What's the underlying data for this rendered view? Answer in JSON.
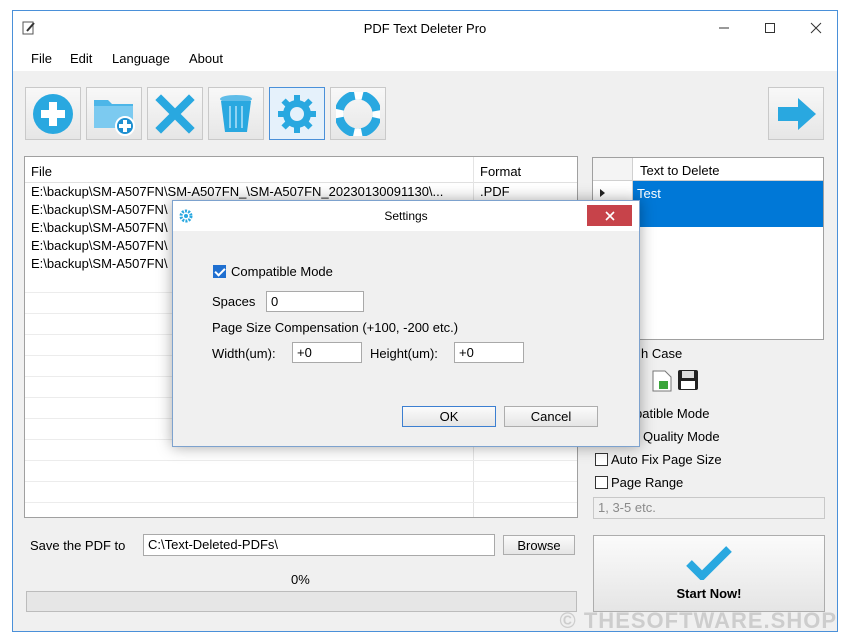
{
  "window": {
    "title": "PDF Text Deleter Pro"
  },
  "menu": [
    "File",
    "Edit",
    "Language",
    "About"
  ],
  "toolbar": {
    "buttons": [
      {
        "icon": "add-icon"
      },
      {
        "icon": "add-folder-icon"
      },
      {
        "icon": "remove-icon"
      },
      {
        "icon": "trash-icon"
      },
      {
        "icon": "gear-icon"
      },
      {
        "icon": "help-lifebuoy-icon"
      }
    ],
    "next_icon": "arrow-right-icon"
  },
  "file_table": {
    "headers": {
      "file": "File",
      "format": "Format"
    },
    "rows": [
      {
        "file": "E:\\backup\\SM-A507FN\\SM-A507FN_\\SM-A507FN_20230130091130\\...",
        "format": ".PDF"
      },
      {
        "file": "E:\\backup\\SM-A507FN\\",
        "format": ""
      },
      {
        "file": "E:\\backup\\SM-A507FN\\",
        "format": ""
      },
      {
        "file": "E:\\backup\\SM-A507FN\\",
        "format": ""
      },
      {
        "file": "E:\\backup\\SM-A507FN\\",
        "format": ""
      }
    ]
  },
  "delete_table": {
    "header": "Text to Delete",
    "rows": [
      "Test",
      ""
    ]
  },
  "options": {
    "match_case": "h Case",
    "compatible_mode": "patible Mode",
    "quality_mode": "Quality Mode",
    "auto_fix": "Auto Fix Page Size",
    "page_range": "Page Range",
    "page_range_placeholder": "1, 3-5 etc."
  },
  "save": {
    "label": "Save the PDF to",
    "path": "C:\\Text-Deleted-PDFs\\",
    "browse": "Browse"
  },
  "progress": {
    "text": "0%",
    "value": 0
  },
  "start": {
    "label": "Start Now!"
  },
  "dialog": {
    "title": "Settings",
    "compatible_mode": "Compatible Mode",
    "spaces_label": "Spaces",
    "spaces_value": "0",
    "compensation_label": "Page Size Compensation (+100, -200 etc.)",
    "width_label": "Width(um):",
    "width_value": "+0",
    "height_label": "Height(um):",
    "height_value": "+0",
    "ok": "OK",
    "cancel": "Cancel"
  },
  "watermark": "© THESOFTWARE.SHOP",
  "colors": {
    "accent": "#1f6fd0",
    "icon_blue": "#29a8e0",
    "selection": "#0078d7",
    "close_red": "#e81123"
  }
}
